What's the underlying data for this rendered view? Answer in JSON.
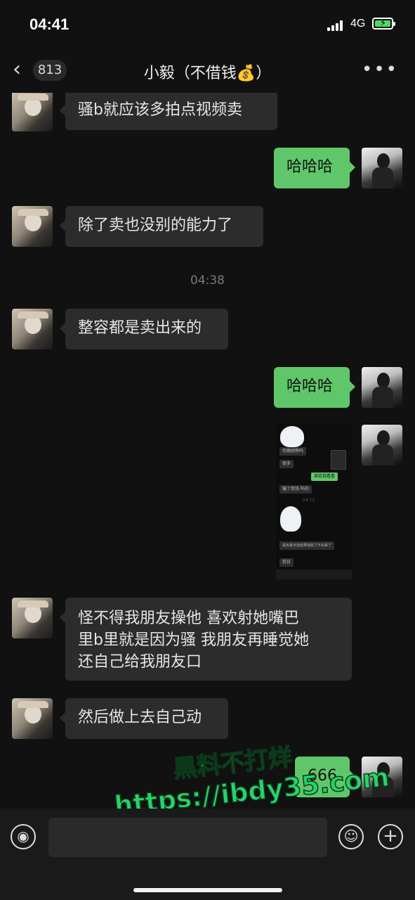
{
  "status": {
    "time": "04:41",
    "network": "4G",
    "battery_color": "#4cd964"
  },
  "nav": {
    "back_icon": "chevron-left",
    "unread_count": "813",
    "title": "小毅（不借钱💰）",
    "more_icon": "more-horizontal"
  },
  "messages": [
    {
      "side": "in",
      "text": "骚b就应该多拍点视频卖"
    },
    {
      "side": "out",
      "text": "哈哈哈"
    },
    {
      "side": "in",
      "text": "除了卖也没别的能力了"
    },
    {
      "side": "time",
      "text": "04:38"
    },
    {
      "side": "in",
      "text": "整容都是卖出来的"
    },
    {
      "side": "out",
      "text": "哈哈哈"
    },
    {
      "side": "out",
      "type": "image",
      "text": "screenshot"
    },
    {
      "side": "in",
      "text": "怪不得我朋友操他 喜欢射她嘴巴\n里b里就是因为骚 我朋友再睡觉她\n还自己给我朋友口"
    },
    {
      "side": "in",
      "text": "然后做上去自己动"
    },
    {
      "side": "out",
      "text": "666"
    }
  ],
  "screenshot": {
    "lines": [
      "你跟她熟吗",
      "很多",
      "某给我看看",
      "骗了我钱 吗的",
      "04:12",
      "说出来日批结果钱收了不出来了",
      "我日"
    ]
  },
  "watermark": {
    "line1": "黑料不打烊",
    "line2": "https://ibdy35.com"
  },
  "input": {
    "voice_icon": "voice",
    "emoji_icon": "emoji",
    "add_icon": "plus"
  },
  "colors": {
    "background": "#111111",
    "incoming": "#2c2c2c",
    "outgoing": "#5fc769",
    "watermark": "#27d36a"
  }
}
